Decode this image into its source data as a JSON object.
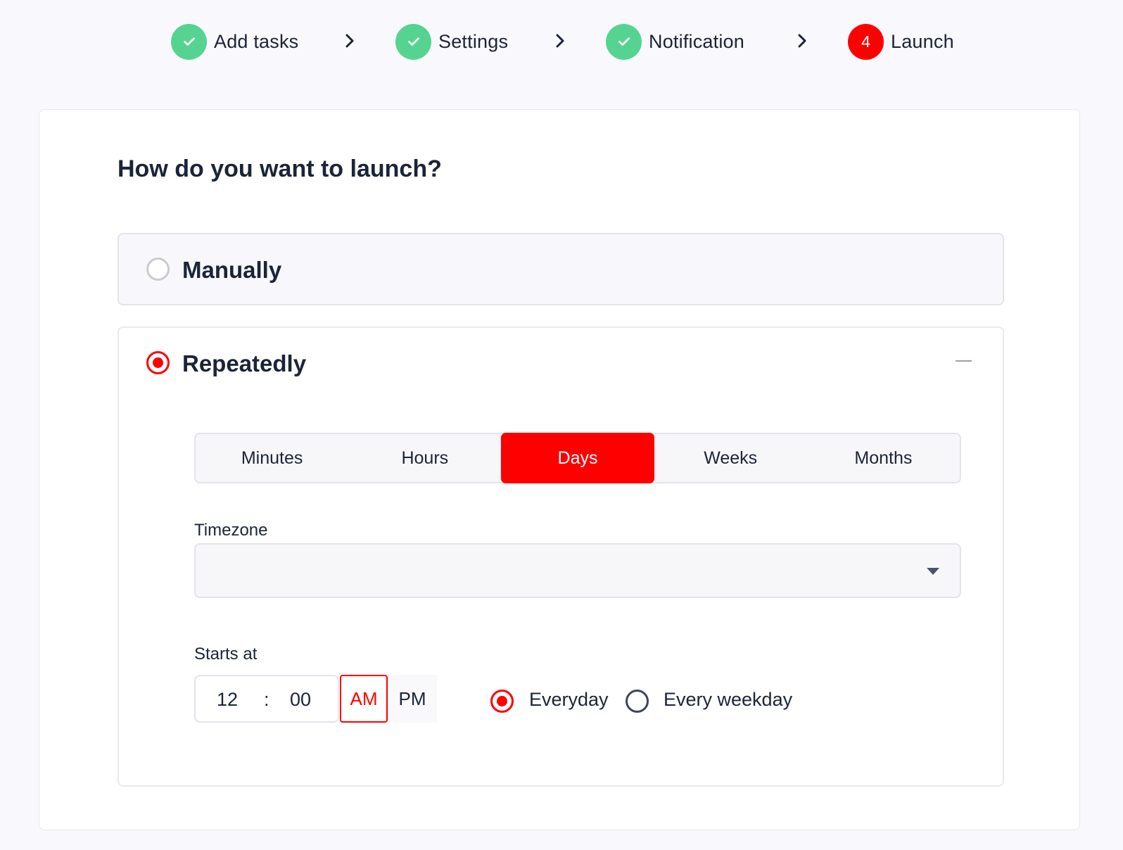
{
  "stepper": {
    "steps": [
      {
        "label": "Add tasks",
        "state": "done",
        "icon": "check-icon"
      },
      {
        "label": "Settings",
        "state": "done",
        "icon": "check-icon"
      },
      {
        "label": "Notification",
        "state": "done",
        "icon": "check-icon"
      },
      {
        "label": "Launch",
        "state": "current",
        "number": "4"
      }
    ],
    "separator_icon": "chevron-right-icon"
  },
  "colors": {
    "accent": "#ff0000",
    "done": "#55d491",
    "text": "#1b2437",
    "page_bg": "#f8f8fd"
  },
  "launch": {
    "title": "How do you want to launch?",
    "options": {
      "manual": {
        "label": "Manually",
        "selected": false
      },
      "repeat": {
        "label": "Repeatedly",
        "selected": true,
        "expanded": true
      }
    },
    "periods": [
      "Minutes",
      "Hours",
      "Days",
      "Weeks",
      "Months"
    ],
    "selected_period": "Days",
    "timezone": {
      "label": "Timezone",
      "value": "",
      "icon": "caret-down-icon"
    },
    "starts_at": {
      "label": "Starts at",
      "hour": "12",
      "separator": ":",
      "minute": "00",
      "am": "AM",
      "pm": "PM",
      "meridiem": "AM"
    },
    "frequency": {
      "everyday": "Everyday",
      "every_weekday": "Every weekday",
      "selected": "Everyday"
    }
  }
}
